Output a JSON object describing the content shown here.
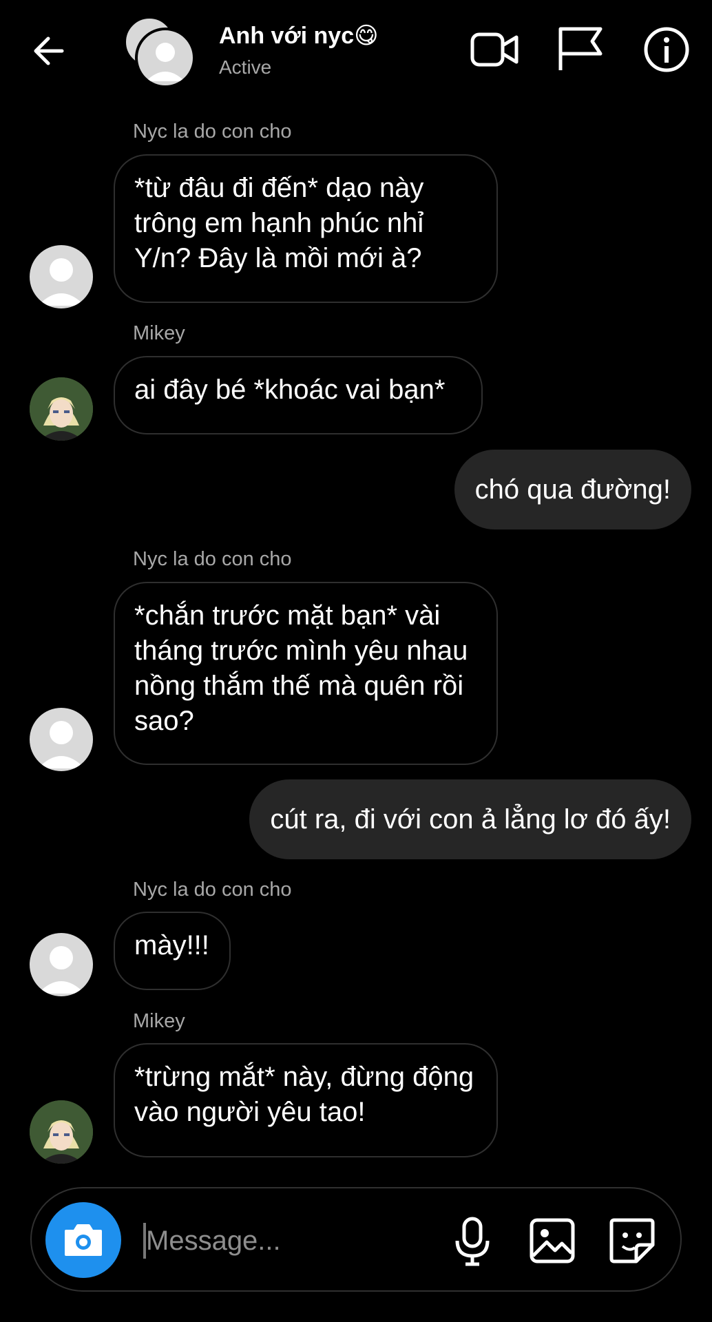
{
  "header": {
    "title": "Anh với nyc😋",
    "status": "Active",
    "icons": [
      "back-arrow-icon",
      "video-call-icon",
      "flag-icon",
      "info-icon"
    ]
  },
  "messages": [
    {
      "sender": "Nyc la do con cho",
      "text": "*từ đâu đi đến* dạo này trông em hạnh phúc nhỉ Y/n? Đây là mồi mới à?"
    },
    {
      "sender": "Mikey",
      "text": "ai đây bé *khoác vai bạn*"
    },
    {
      "text": "chó qua đường!"
    },
    {
      "sender": "Nyc la do con cho",
      "text": "*chắn trước mặt bạn* vài tháng trước mình yêu nhau nồng thắm thế mà quên rồi sao?"
    },
    {
      "text": "cút ra, đi với con ả lẳng lơ đó ấy!"
    },
    {
      "sender": "Nyc la do con cho",
      "text": "mày!!!"
    },
    {
      "sender": "Mikey",
      "text": "*trừng mắt* này, đừng động vào người yêu tao!"
    }
  ],
  "composer": {
    "placeholder": "Message...",
    "icons": [
      "camera-icon",
      "microphone-icon",
      "gallery-icon",
      "sticker-icon"
    ]
  },
  "colors": {
    "background": "#000000",
    "outgoing_bubble": "#262626",
    "camera_button": "#1e90ee",
    "secondary_text": "#a8a8a8"
  }
}
